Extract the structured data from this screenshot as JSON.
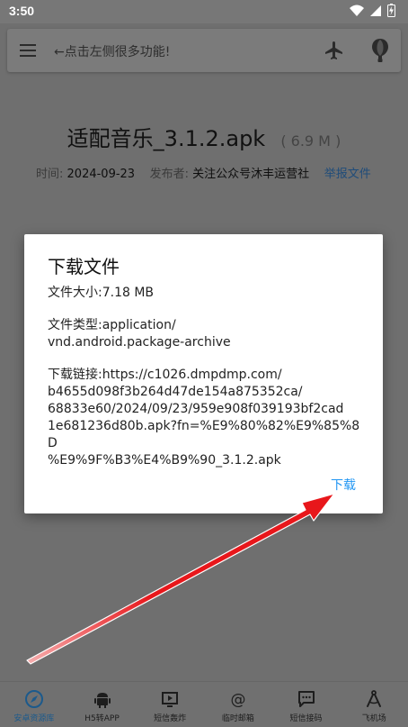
{
  "status_bar": {
    "time": "3:50"
  },
  "app_bar": {
    "hint": "←点击左侧很多功能!"
  },
  "file": {
    "name": "适配音乐_3.1.2.apk",
    "size": "( 6.9 M )",
    "time_label": "时间:",
    "time_value": "2024-09-23",
    "publisher_label": "发布者:",
    "publisher_value": "关注公众号沐丰运营社",
    "report_label": "举报文件"
  },
  "dialog": {
    "title": "下载文件",
    "size_line": "文件大小:7.18 MB",
    "type_line": "文件类型:application/\nvnd.android.package-archive",
    "link_line": "下载链接:https://c1026.dmpdmp.com/\nb4655d098f3b264d47de154a875352ca/\n68833e60/2024/09/23/959e908f039193bf2cad\n1e681236d80b.apk?fn=%E9%80%82%E9%85%8D\n%E9%9F%B3%E4%B9%90_3.1.2.apk",
    "download_button": "下载"
  },
  "bottom_nav": {
    "items": [
      {
        "label": "安卓资源库",
        "icon": "compass-icon"
      },
      {
        "label": "H5转APP",
        "icon": "android-icon"
      },
      {
        "label": "短信轰炸",
        "icon": "tv-icon"
      },
      {
        "label": "临时邮箱",
        "icon": "at-icon"
      },
      {
        "label": "短信接码",
        "icon": "chat-icon"
      },
      {
        "label": "飞机场",
        "icon": "compass-draw-icon"
      }
    ]
  },
  "colors": {
    "accent": "#2196f3",
    "arrow": "#e8171b",
    "overlay": "#6f6f6f",
    "active_nav": "#1c5a8c"
  }
}
